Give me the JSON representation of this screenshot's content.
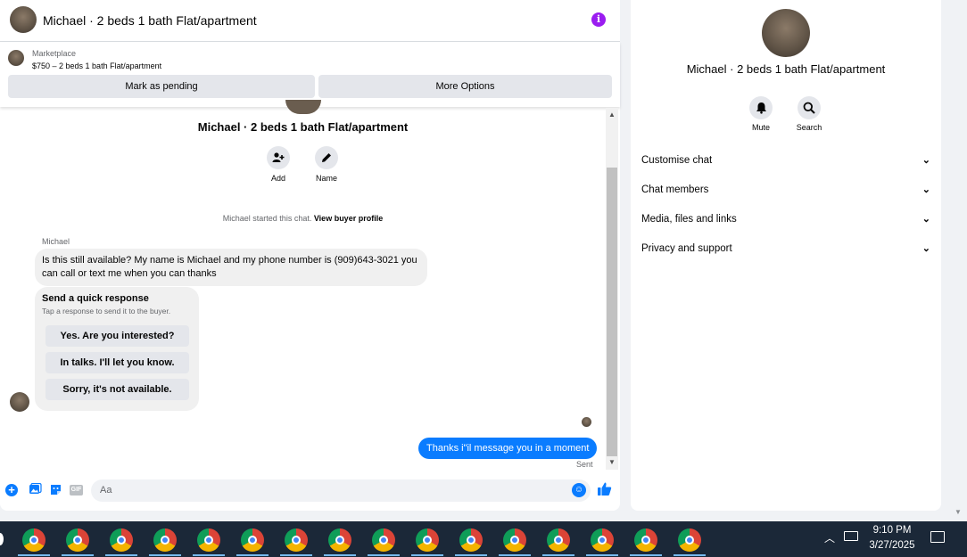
{
  "header": {
    "title": "Michael · 2 beds 1 bath Flat/apartment",
    "info_icon": "info-icon"
  },
  "marketplace": {
    "label": "Marketplace",
    "listing": "$750 – 2 beds 1 bath Flat/apartment",
    "pending_label": "Mark as pending",
    "more_label": "More Options"
  },
  "conversation": {
    "title": "Michael · 2 beds 1 bath Flat/apartment",
    "add_label": "Add",
    "name_label": "Name",
    "started_text": "Michael started this chat.",
    "view_profile": "View buyer profile",
    "sender_name": "Michael",
    "incoming_message": "Is this still available? My name is Michael and my phone number is (909)643-3021 you can call or text me when you can thanks",
    "quick_title": "Send a quick response",
    "quick_subtitle": "Tap a response to send it to the buyer.",
    "quick_options": [
      "Yes. Are you interested?",
      "In talks. I'll let you know.",
      "Sorry, it's not available."
    ],
    "outgoing_message": "Thanks i\"il message you in a moment",
    "sent_status": "Sent"
  },
  "composer": {
    "placeholder": "Aa"
  },
  "sidebar": {
    "title": "Michael · 2 beds 1 bath Flat/apartment",
    "mute_label": "Mute",
    "search_label": "Search",
    "items": [
      {
        "label": "Customise chat"
      },
      {
        "label": "Chat members"
      },
      {
        "label": "Media, files and links"
      },
      {
        "label": "Privacy and support"
      }
    ]
  },
  "taskbar": {
    "app_icon": "chrome-icon",
    "app_count": 16,
    "time": "9:10 PM",
    "date": "3/27/2025"
  },
  "colors": {
    "accent": "#0a7cff",
    "info": "#9a1cf0",
    "taskbar": "#1b2838"
  }
}
